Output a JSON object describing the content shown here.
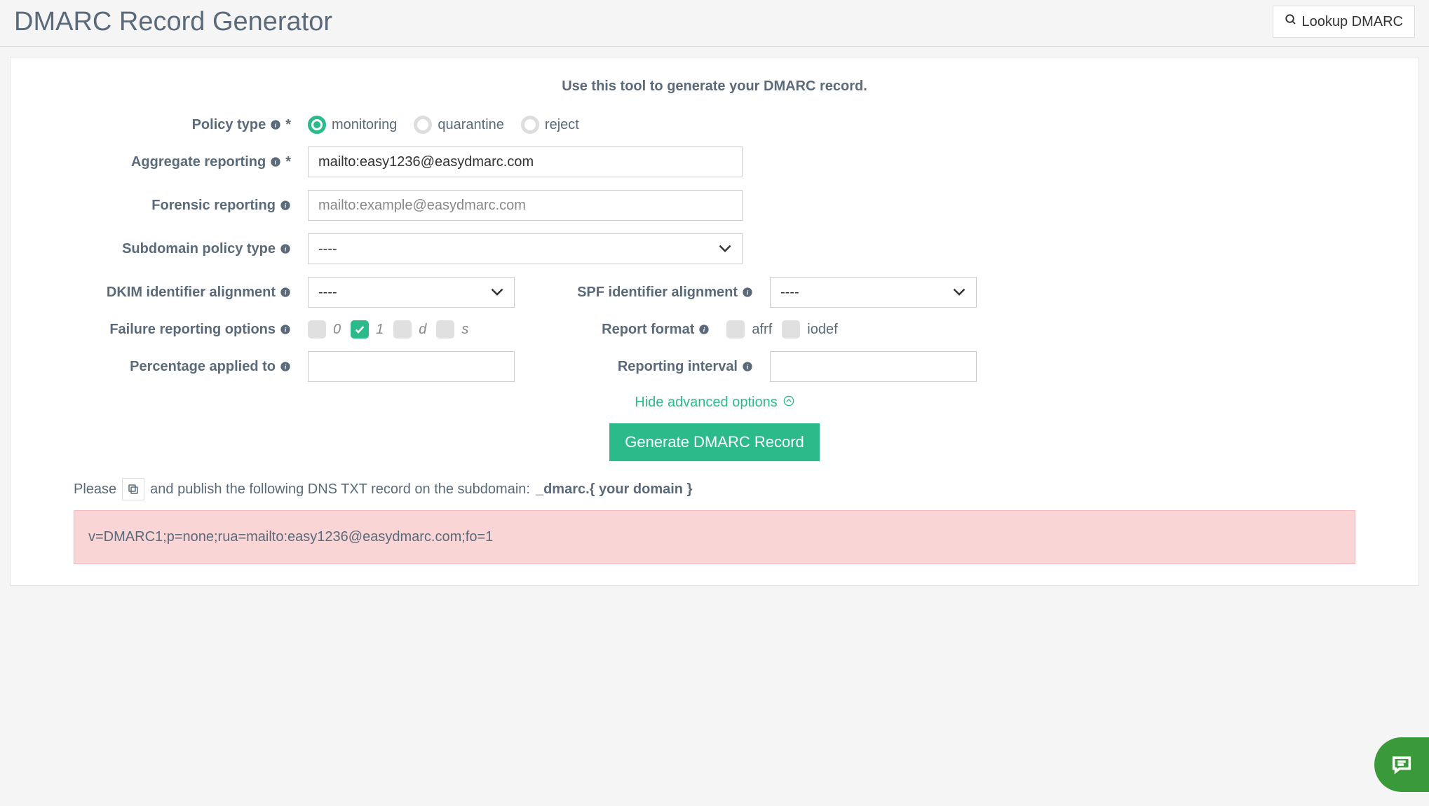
{
  "header": {
    "title": "DMARC Record Generator",
    "lookup_label": "Lookup DMARC"
  },
  "intro": "Use this tool to generate your DMARC record.",
  "labels": {
    "policy_type": "Policy type",
    "aggregate_reporting": "Aggregate reporting",
    "forensic_reporting": "Forensic reporting",
    "subdomain_policy": "Subdomain policy type",
    "dkim_alignment": "DKIM identifier alignment",
    "spf_alignment": "SPF identifier alignment",
    "failure_options": "Failure reporting options",
    "report_format": "Report format",
    "percentage": "Percentage applied to",
    "reporting_interval": "Reporting interval",
    "required_mark": "*"
  },
  "policy_options": {
    "monitoring": "monitoring",
    "quarantine": "quarantine",
    "reject": "reject",
    "selected": "monitoring"
  },
  "inputs": {
    "aggregate_value": "mailto:easy1236@easydmarc.com",
    "forensic_placeholder": "mailto:example@easydmarc.com",
    "subdomain_value": "----",
    "dkim_value": "----",
    "spf_value": "----",
    "percentage_value": "",
    "interval_value": ""
  },
  "failure_opts": {
    "opt0": {
      "label": "0",
      "checked": false
    },
    "opt1": {
      "label": "1",
      "checked": true
    },
    "optd": {
      "label": "d",
      "checked": false
    },
    "opts": {
      "label": "s",
      "checked": false
    }
  },
  "report_formats": {
    "afrf": {
      "label": "afrf",
      "checked": false
    },
    "iodef": {
      "label": "iodef",
      "checked": false
    }
  },
  "toggle_label": "Hide advanced options",
  "generate_label": "Generate DMARC Record",
  "result": {
    "prefix": "Please",
    "mid": "and publish the following DNS TXT record on the subdomain:",
    "subdomain": "_dmarc.{ your domain }",
    "record": "v=DMARC1;p=none;rua=mailto:easy1236@easydmarc.com;fo=1"
  }
}
